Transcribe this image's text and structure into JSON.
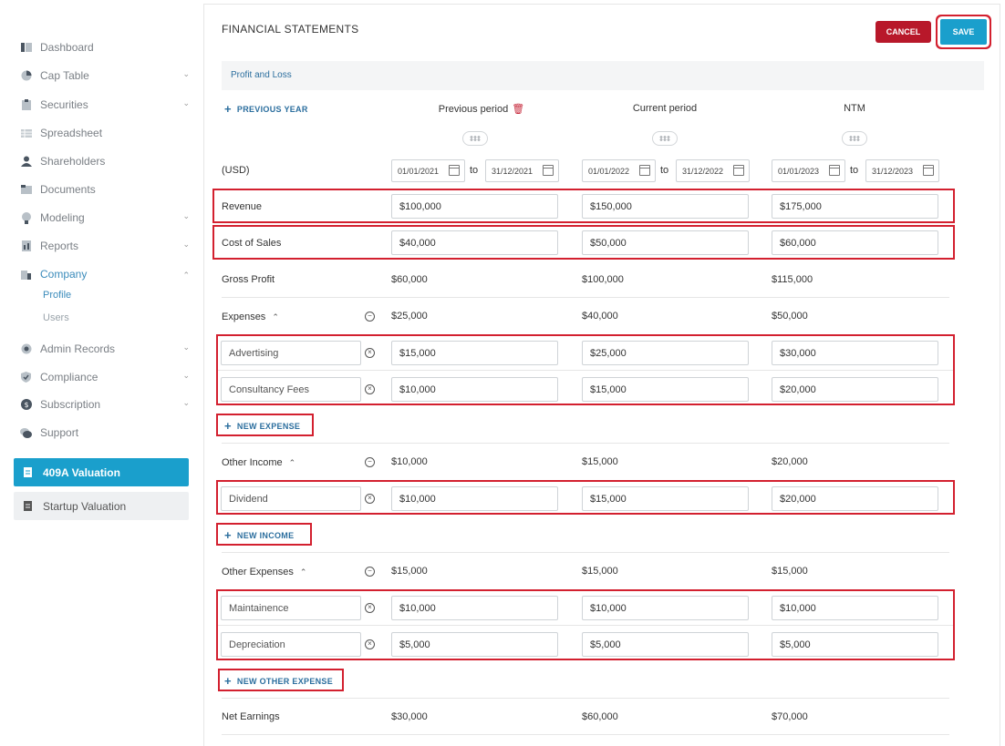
{
  "sidebar": {
    "items": [
      {
        "label": "Dashboard",
        "icon": "dashboard-icon"
      },
      {
        "label": "Cap Table",
        "icon": "pie-chart-icon"
      },
      {
        "label": "Securities",
        "icon": "clipboard-icon"
      },
      {
        "label": "Spreadsheet",
        "icon": "spreadsheet-icon"
      },
      {
        "label": "Shareholders",
        "icon": "person-icon"
      },
      {
        "label": "Documents",
        "icon": "folder-icon"
      },
      {
        "label": "Modeling",
        "icon": "bulb-icon"
      },
      {
        "label": "Reports",
        "icon": "report-icon"
      },
      {
        "label": "Company",
        "icon": "building-icon"
      },
      {
        "label": "Admin Records",
        "icon": "admin-records-icon"
      },
      {
        "label": "Compliance",
        "icon": "shield-check-icon"
      },
      {
        "label": "Subscription",
        "icon": "dollar-icon"
      },
      {
        "label": "Support",
        "icon": "chat-icon"
      }
    ],
    "company_sub": [
      "Profile",
      "Users"
    ],
    "valuation_primary": "409A Valuation",
    "valuation_secondary": "Startup Valuation"
  },
  "header": {
    "title": "FINANCIAL STATEMENTS",
    "cancel_label": "CANCEL",
    "save_label": "SAVE"
  },
  "section": {
    "title": "Profit and Loss"
  },
  "previous_year_label": "PREVIOUS YEAR",
  "columns": [
    "Previous period",
    "Current period",
    "NTM"
  ],
  "currency_label": "(USD)",
  "to_label": "to",
  "dates": [
    {
      "from": "01/01/2021",
      "to": "31/12/2021"
    },
    {
      "from": "01/01/2022",
      "to": "31/12/2022"
    },
    {
      "from": "01/01/2023",
      "to": "31/12/2023"
    }
  ],
  "revenue": {
    "label": "Revenue",
    "values": [
      "$100,000",
      "$150,000",
      "$175,000"
    ]
  },
  "cost_of_sales": {
    "label": "Cost of Sales",
    "values": [
      "$40,000",
      "$50,000",
      "$60,000"
    ]
  },
  "gross_profit": {
    "label": "Gross Profit",
    "values": [
      "$60,000",
      "$100,000",
      "$115,000"
    ]
  },
  "expenses": {
    "label": "Expenses",
    "totals": [
      "$25,000",
      "$40,000",
      "$50,000"
    ],
    "items": [
      {
        "name": "Advertising",
        "values": [
          "$15,000",
          "$25,000",
          "$30,000"
        ]
      },
      {
        "name": "Consultancy Fees",
        "values": [
          "$10,000",
          "$15,000",
          "$20,000"
        ]
      }
    ],
    "add_label": "NEW EXPENSE"
  },
  "other_income": {
    "label": "Other Income",
    "totals": [
      "$10,000",
      "$15,000",
      "$20,000"
    ],
    "items": [
      {
        "name": "Dividend",
        "values": [
          "$10,000",
          "$15,000",
          "$20,000"
        ]
      }
    ],
    "add_label": "NEW INCOME"
  },
  "other_expenses": {
    "label": "Other Expenses",
    "totals": [
      "$15,000",
      "$15,000",
      "$15,000"
    ],
    "items": [
      {
        "name": "Maintainence",
        "values": [
          "$10,000",
          "$10,000",
          "$10,000"
        ]
      },
      {
        "name": "Depreciation",
        "values": [
          "$5,000",
          "$5,000",
          "$5,000"
        ]
      }
    ],
    "add_label": "NEW OTHER EXPENSE"
  },
  "net_earnings": {
    "label": "Net Earnings",
    "values": [
      "$30,000",
      "$60,000",
      "$70,000"
    ]
  },
  "colors": {
    "accent": "#1a9fcc",
    "danger": "#b8182a",
    "highlight": "#d3202f",
    "link": "#2b6e9e"
  }
}
